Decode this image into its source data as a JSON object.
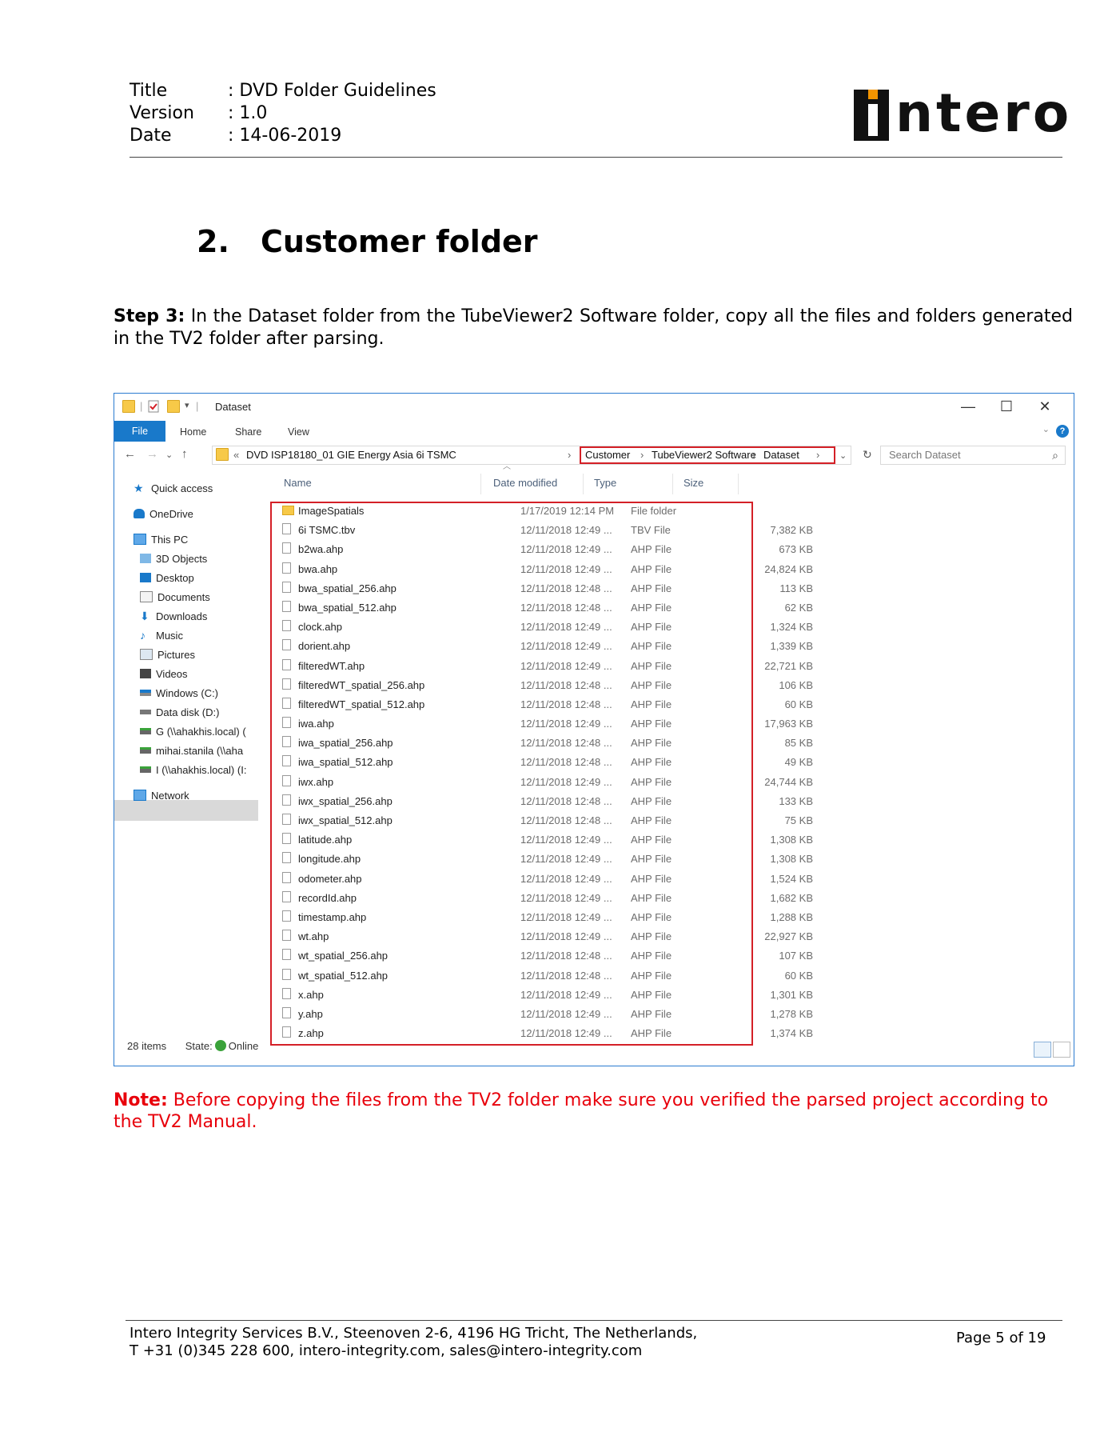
{
  "header": {
    "title_key": "Title",
    "title_val": ": DVD Folder Guidelines",
    "version_key": "Version",
    "version_val": ": 1.0",
    "date_key": "Date",
    "date_val": ": 14-06-2019",
    "logo_text": "intero"
  },
  "section": {
    "number": "2.",
    "title": "Customer folder"
  },
  "step": {
    "label": "Step 3:",
    "text": " In the Dataset folder from the TubeViewer2 Software folder, copy all the files and folders generated in the TV2 folder after parsing."
  },
  "explorer": {
    "window_title": "Dataset",
    "controls": {
      "minimize": "—",
      "maximize": "☐",
      "close": "✕"
    },
    "ribbon": {
      "file": "File",
      "home": "Home",
      "share": "Share",
      "view": "View",
      "help": "?"
    },
    "nav": {
      "back": "←",
      "forward": "→",
      "recent": "⌄",
      "up": "↑"
    },
    "address": {
      "prefix": "«",
      "parent": "DVD ISP18180_01 GIE Energy Asia 6i TSMC",
      "sep": "›",
      "crumbs": [
        "Customer",
        "TubeViewer2 Software",
        "Dataset"
      ]
    },
    "search_placeholder": "Search Dataset",
    "nav_pane": [
      "Quick access",
      "OneDrive",
      "This PC",
      "3D Objects",
      "Desktop",
      "Documents",
      "Downloads",
      "Music",
      "Pictures",
      "Videos",
      "Windows (C:)",
      "Data disk (D:)",
      "G (\\\\ahakhis.local) (",
      "mihai.stanila (\\\\aha",
      "I (\\\\ahakhis.local) (I:",
      "Network"
    ],
    "columns": {
      "name": "Name",
      "date": "Date modified",
      "type": "Type",
      "size": "Size"
    },
    "files": [
      {
        "name": "ImageSpatials",
        "date": "1/17/2019 12:14 PM",
        "type": "File folder",
        "size": "",
        "folder": true
      },
      {
        "name": "6i TSMC.tbv",
        "date": "12/11/2018 12:49 ...",
        "type": "TBV File",
        "size": "7,382 KB"
      },
      {
        "name": "b2wa.ahp",
        "date": "12/11/2018 12:49 ...",
        "type": "AHP File",
        "size": "673 KB"
      },
      {
        "name": "bwa.ahp",
        "date": "12/11/2018 12:49 ...",
        "type": "AHP File",
        "size": "24,824 KB"
      },
      {
        "name": "bwa_spatial_256.ahp",
        "date": "12/11/2018 12:48 ...",
        "type": "AHP File",
        "size": "113 KB"
      },
      {
        "name": "bwa_spatial_512.ahp",
        "date": "12/11/2018 12:48 ...",
        "type": "AHP File",
        "size": "62 KB"
      },
      {
        "name": "clock.ahp",
        "date": "12/11/2018 12:49 ...",
        "type": "AHP File",
        "size": "1,324 KB"
      },
      {
        "name": "dorient.ahp",
        "date": "12/11/2018 12:49 ...",
        "type": "AHP File",
        "size": "1,339 KB"
      },
      {
        "name": "filteredWT.ahp",
        "date": "12/11/2018 12:49 ...",
        "type": "AHP File",
        "size": "22,721 KB"
      },
      {
        "name": "filteredWT_spatial_256.ahp",
        "date": "12/11/2018 12:48 ...",
        "type": "AHP File",
        "size": "106 KB"
      },
      {
        "name": "filteredWT_spatial_512.ahp",
        "date": "12/11/2018 12:48 ...",
        "type": "AHP File",
        "size": "60 KB"
      },
      {
        "name": "iwa.ahp",
        "date": "12/11/2018 12:49 ...",
        "type": "AHP File",
        "size": "17,963 KB"
      },
      {
        "name": "iwa_spatial_256.ahp",
        "date": "12/11/2018 12:48 ...",
        "type": "AHP File",
        "size": "85 KB"
      },
      {
        "name": "iwa_spatial_512.ahp",
        "date": "12/11/2018 12:48 ...",
        "type": "AHP File",
        "size": "49 KB"
      },
      {
        "name": "iwx.ahp",
        "date": "12/11/2018 12:49 ...",
        "type": "AHP File",
        "size": "24,744 KB"
      },
      {
        "name": "iwx_spatial_256.ahp",
        "date": "12/11/2018 12:48 ...",
        "type": "AHP File",
        "size": "133 KB"
      },
      {
        "name": "iwx_spatial_512.ahp",
        "date": "12/11/2018 12:48 ...",
        "type": "AHP File",
        "size": "75 KB"
      },
      {
        "name": "latitude.ahp",
        "date": "12/11/2018 12:49 ...",
        "type": "AHP File",
        "size": "1,308 KB"
      },
      {
        "name": "longitude.ahp",
        "date": "12/11/2018 12:49 ...",
        "type": "AHP File",
        "size": "1,308 KB"
      },
      {
        "name": "odometer.ahp",
        "date": "12/11/2018 12:49 ...",
        "type": "AHP File",
        "size": "1,524 KB"
      },
      {
        "name": "recordId.ahp",
        "date": "12/11/2018 12:49 ...",
        "type": "AHP File",
        "size": "1,682 KB"
      },
      {
        "name": "timestamp.ahp",
        "date": "12/11/2018 12:49 ...",
        "type": "AHP File",
        "size": "1,288 KB"
      },
      {
        "name": "wt.ahp",
        "date": "12/11/2018 12:49 ...",
        "type": "AHP File",
        "size": "22,927 KB"
      },
      {
        "name": "wt_spatial_256.ahp",
        "date": "12/11/2018 12:48 ...",
        "type": "AHP File",
        "size": "107 KB"
      },
      {
        "name": "wt_spatial_512.ahp",
        "date": "12/11/2018 12:48 ...",
        "type": "AHP File",
        "size": "60 KB"
      },
      {
        "name": "x.ahp",
        "date": "12/11/2018 12:49 ...",
        "type": "AHP File",
        "size": "1,301 KB"
      },
      {
        "name": "y.ahp",
        "date": "12/11/2018 12:49 ...",
        "type": "AHP File",
        "size": "1,278 KB"
      },
      {
        "name": "z.ahp",
        "date": "12/11/2018 12:49 ...",
        "type": "AHP File",
        "size": "1,374 KB"
      }
    ],
    "status": {
      "count": "28 items",
      "state_label": "State:",
      "state_value": "Online"
    },
    "colors": {
      "accent": "#1979ca",
      "highlight": "#d42027",
      "folder": "#f7c948"
    }
  },
  "note": {
    "label": "Note:",
    "text": " Before copying the files from the TV2 folder make sure you verified the parsed project according to the TV2 Manual."
  },
  "footer": {
    "line1": "Intero Integrity Services B.V., Steenoven 2-6, 4196 HG Tricht, The Netherlands,",
    "line2": "T +31 (0)345 228 600, intero-integrity.com, sales@intero-integrity.com",
    "page": "Page 5 of 19"
  }
}
